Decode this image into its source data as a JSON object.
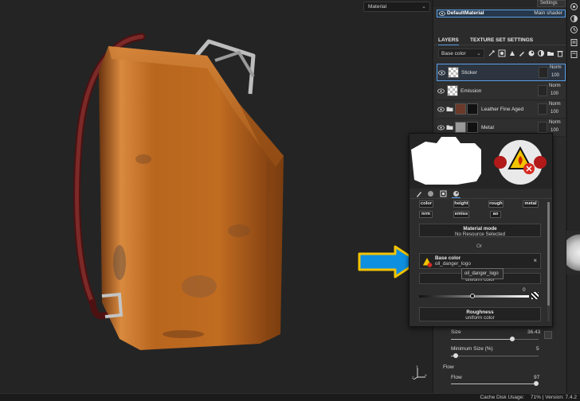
{
  "viewport": {
    "material_dropdown": "Material"
  },
  "panel": {
    "settings_label": "Settings",
    "material_name": "DefaultMaterial",
    "material_shader": "Main shader",
    "tabs": [
      "LAYERS",
      "TEXTURE SET SETTINGS"
    ],
    "channel": "Base color",
    "layers": [
      {
        "name": "Sticker",
        "blend": "Norm",
        "opacity": "100",
        "selected": true,
        "folder": false
      },
      {
        "name": "Emission",
        "blend": "Norm",
        "opacity": "100",
        "selected": false,
        "folder": false
      },
      {
        "name": "Leather Fine Aged",
        "blend": "Norm",
        "opacity": "100",
        "selected": false,
        "folder": true
      },
      {
        "name": "Metal",
        "blend": "Norm",
        "opacity": "100",
        "selected": false,
        "folder": true
      }
    ],
    "lower": {
      "value_03": "0.3",
      "size_label": "Size",
      "size_value": "36.43",
      "size_fraction": 0.7,
      "min_size_label": "Minimum Size (%)",
      "min_size_value": "5",
      "min_size_fraction": 0.05,
      "flow_header": "Flow",
      "flow_label": "Flow",
      "flow_value": "97",
      "flow_fraction": 0.97
    }
  },
  "popup": {
    "chips_row": [
      "color",
      "height",
      "rough",
      "metal"
    ],
    "chips_row2": [
      "nrm",
      "emiss",
      "ao"
    ],
    "material_mode_title": "Material mode",
    "material_mode_value": "No Resource Selected",
    "or_label": "Or",
    "base_color_title": "Base color",
    "base_color_resource": "oil_danger_logo",
    "uniform_color": "uniform color",
    "gradient_value": "0",
    "roughness_title": "Roughness",
    "roughness_value": "uniform color"
  },
  "tooltip": "oil_danger_logo",
  "status": {
    "cache_label": "Cache Disk Usage:",
    "cache_value": "71%",
    "version": "Version: 7.4.2"
  },
  "colors": {
    "accent": "#5aa0e6",
    "arrow_fill": "#0f8fe0",
    "arrow_outline": "#f4c400",
    "body_copper": "#c7701f",
    "strap": "#6a1c1c"
  }
}
